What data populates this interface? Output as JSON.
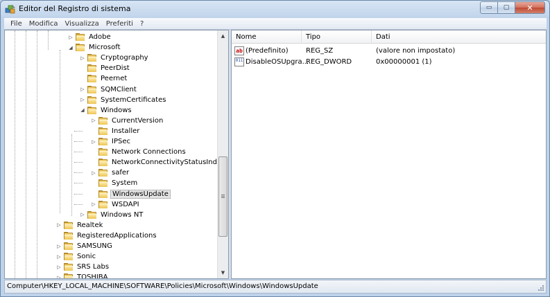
{
  "window": {
    "title": "Editor del Registro di sistema",
    "controls": {
      "minimize": "▭",
      "maximize": "▢",
      "close": "✕"
    }
  },
  "menu": [
    "File",
    "Modifica",
    "Visualizza",
    "Preferiti",
    "?"
  ],
  "tree": {
    "items": [
      {
        "label": "Adobe",
        "expander": "▷",
        "selected": false
      },
      {
        "label": "Microsoft",
        "expander": "◢",
        "selected": false
      },
      {
        "label": "Cryptography",
        "expander": "▷",
        "selected": false
      },
      {
        "label": "PeerDist",
        "expander": "",
        "selected": false
      },
      {
        "label": "Peernet",
        "expander": "",
        "selected": false
      },
      {
        "label": "SQMClient",
        "expander": "▷",
        "selected": false
      },
      {
        "label": "SystemCertificates",
        "expander": "▷",
        "selected": false
      },
      {
        "label": "Windows",
        "expander": "◢",
        "selected": false
      },
      {
        "label": "CurrentVersion",
        "expander": "▷",
        "selected": false
      },
      {
        "label": "Installer",
        "expander": "",
        "selected": false
      },
      {
        "label": "IPSec",
        "expander": "▷",
        "selected": false
      },
      {
        "label": "Network Connections",
        "expander": "",
        "selected": false
      },
      {
        "label": "NetworkConnectivityStatusIndicator",
        "expander": "",
        "selected": false
      },
      {
        "label": "safer",
        "expander": "▷",
        "selected": false
      },
      {
        "label": "System",
        "expander": "",
        "selected": false
      },
      {
        "label": "WindowsUpdate",
        "expander": "",
        "selected": true
      },
      {
        "label": "WSDAPI",
        "expander": "▷",
        "selected": false
      },
      {
        "label": "Windows NT",
        "expander": "▷",
        "selected": false
      },
      {
        "label": "Realtek",
        "expander": "▷",
        "selected": false
      },
      {
        "label": "RegisteredApplications",
        "expander": "",
        "selected": false
      },
      {
        "label": "SAMSUNG",
        "expander": "▷",
        "selected": false
      },
      {
        "label": "Sonic",
        "expander": "▷",
        "selected": false
      },
      {
        "label": "SRS Labs",
        "expander": "▷",
        "selected": false
      },
      {
        "label": "TOSHIBA",
        "expander": "▷",
        "selected": false
      }
    ],
    "scroll_up_icon": "▲",
    "scroll_down_icon": "▼"
  },
  "list": {
    "columns": [
      "Nome",
      "Tipo",
      "Dati"
    ],
    "rows": [
      {
        "icon": "ab",
        "icon_name": "string-value-icon",
        "name": "(Predefinito)",
        "type": "REG_SZ",
        "data": "(valore non impostato)"
      },
      {
        "icon": "011",
        "icon_name": "dword-value-icon",
        "name": "DisableOSUpgra...",
        "type": "REG_DWORD",
        "data": "0x00000001 (1)"
      }
    ]
  },
  "status": {
    "path": "Computer\\HKEY_LOCAL_MACHINE\\SOFTWARE\\Policies\\Microsoft\\Windows\\WindowsUpdate"
  }
}
